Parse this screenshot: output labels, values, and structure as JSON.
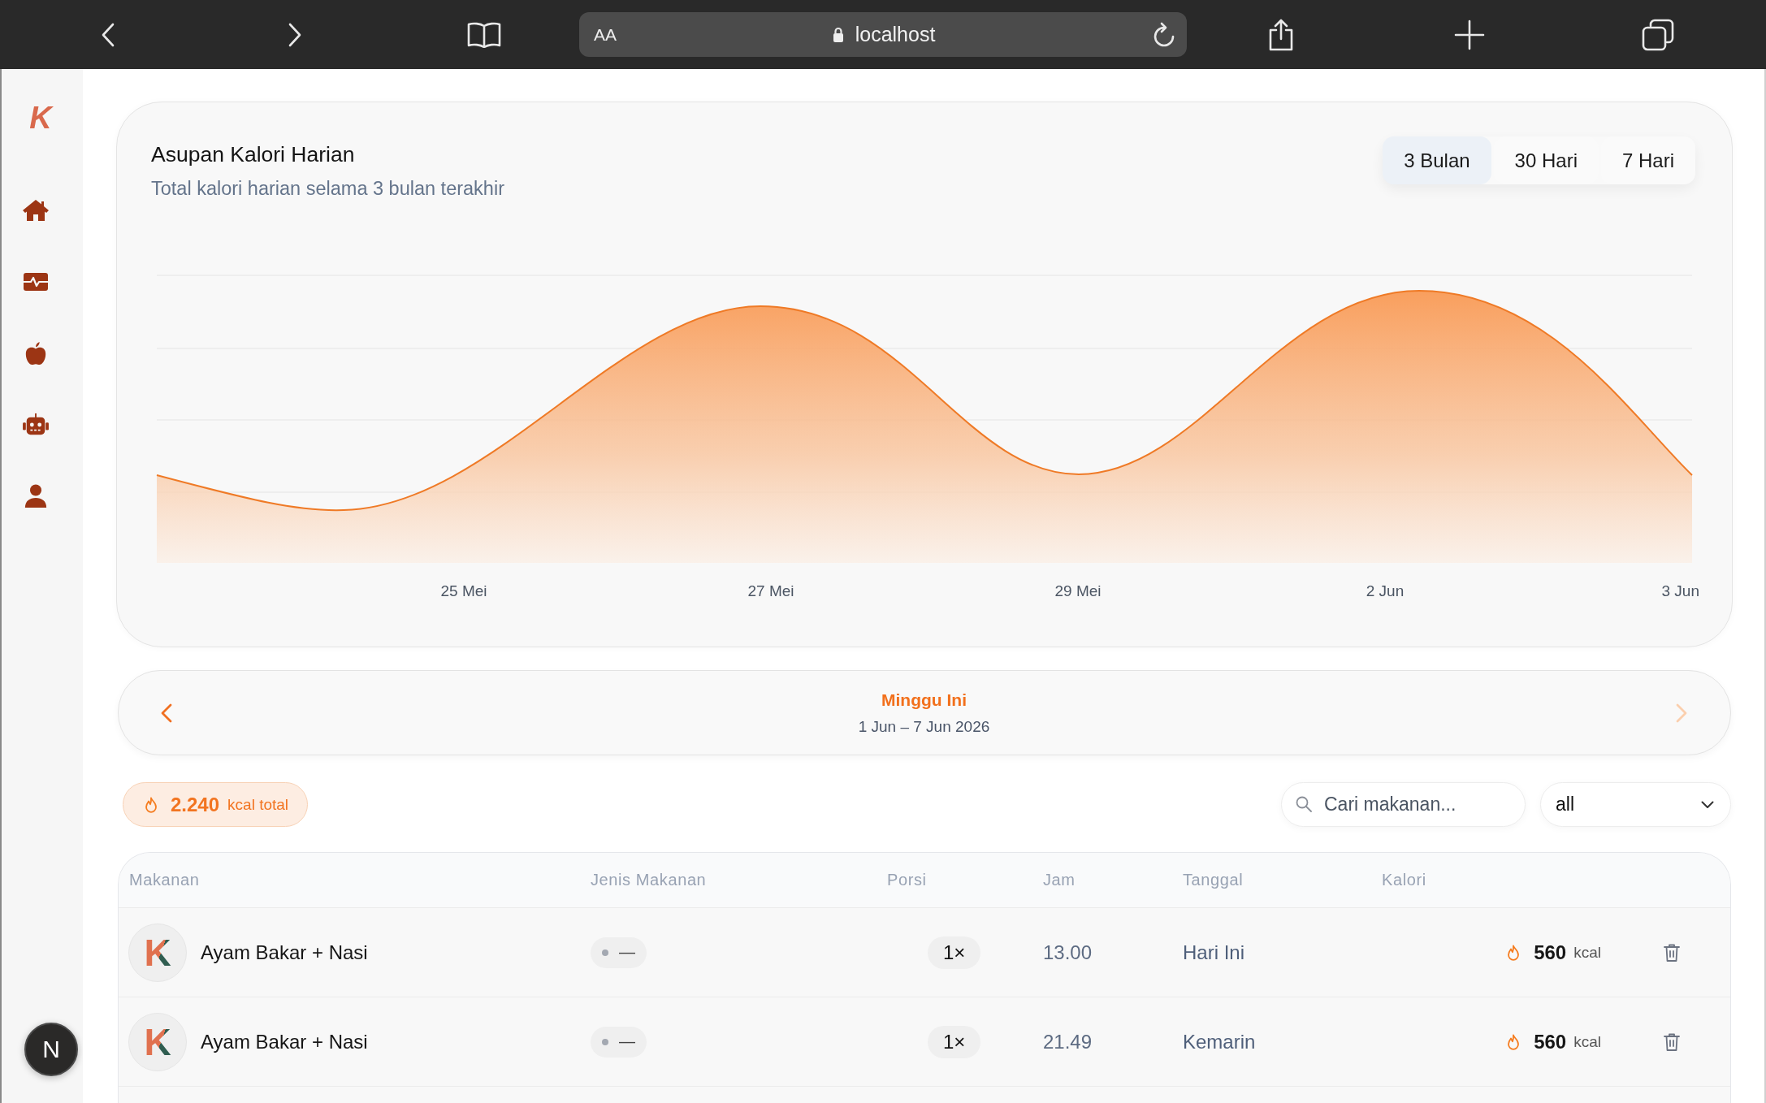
{
  "browser": {
    "text_size_button": "AA",
    "url": "localhost"
  },
  "sidebar": {
    "logo": "K",
    "dev_badge": "N"
  },
  "chart_card": {
    "title": "Asupan Kalori Harian",
    "subtitle": "Total kalori harian selama 3 bulan terakhir",
    "ranges": [
      {
        "label": "3 Bulan",
        "selected": true
      },
      {
        "label": "30 Hari",
        "selected": false
      },
      {
        "label": "7 Hari",
        "selected": false
      }
    ],
    "x_labels": [
      "25 Mei",
      "27 Mei",
      "29 Mei",
      "2 Jun",
      "3 Jun"
    ]
  },
  "week_nav": {
    "title": "Minggu Ini",
    "range": "1 Jun – 7 Jun 2026",
    "prev_disabled": false,
    "next_disabled": true
  },
  "summary": {
    "total": "2.240",
    "unit": "kcal total"
  },
  "search": {
    "placeholder": "Cari makanan..."
  },
  "filter": {
    "value": "all"
  },
  "table": {
    "columns": [
      "Makanan",
      "Jenis Makanan",
      "Porsi",
      "Jam",
      "Tanggal",
      "Kalori"
    ],
    "rows": [
      {
        "thumbnail": "K",
        "name": "Ayam Bakar + Nasi",
        "type": "—",
        "portion": "1×",
        "time": "13.00",
        "date": "Hari Ini",
        "calories": "560",
        "unit": "kcal"
      },
      {
        "thumbnail": "K",
        "name": "Ayam Bakar + Nasi",
        "type": "—",
        "portion": "1×",
        "time": "21.49",
        "date": "Kemarin",
        "calories": "560",
        "unit": "kcal"
      }
    ]
  }
}
